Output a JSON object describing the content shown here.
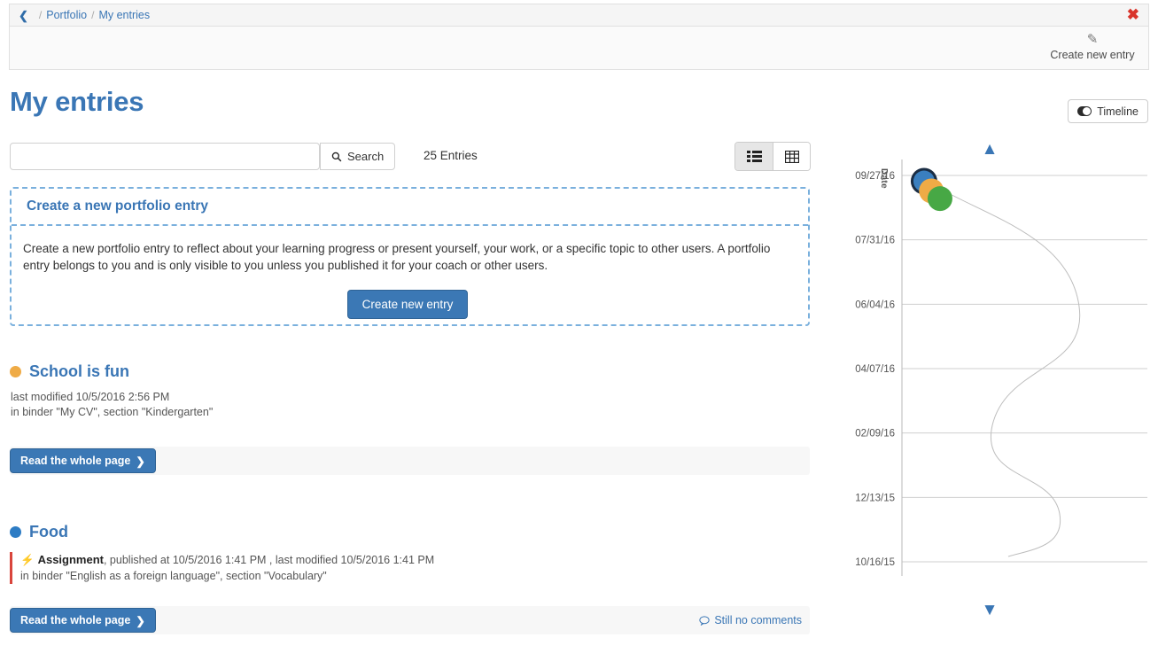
{
  "breadcrumb": {
    "back_icon": "chevron-left-icon",
    "items": [
      "Portfolio",
      "My entries"
    ],
    "separator": "/",
    "close_icon": "close-icon"
  },
  "action_bar": {
    "create_entry": {
      "icon": "pencil-icon",
      "label": "Create new entry"
    }
  },
  "header": {
    "title": "My entries",
    "timeline_toggle": {
      "label": "Timeline",
      "icon": "toggle-switch-icon",
      "state": "on"
    }
  },
  "search": {
    "value": "",
    "placeholder": "",
    "button_label": "Search",
    "button_icon": "search-icon",
    "entries_count": "25 Entries"
  },
  "view_switch": {
    "list": {
      "icon": "list-view-icon",
      "active": true
    },
    "grid": {
      "icon": "grid-view-icon",
      "active": false
    }
  },
  "create_box": {
    "heading": "Create a new portfolio entry",
    "description": "Create a new portfolio entry to reflect about your learning progress or present yourself, your work, or a specific topic to other users. A portfolio entry belongs to you and is only visible to you unless you published it for your coach or other users.",
    "button_label": "Create new entry"
  },
  "entries": [
    {
      "bullet_color": "#efab46",
      "title": "School is fun",
      "meta_lines": [
        "last modified 10/5/2016 2:56 PM",
        "in binder \"My CV\", section \"Kindergarten\""
      ],
      "assignment": null,
      "read_label": "Read the whole page",
      "read_icon": "chevron-right-icon",
      "comments": null
    },
    {
      "bullet_color": "#2d7cc4",
      "title": "Food",
      "meta_lines": [],
      "assignment": {
        "icon": "bolt-icon",
        "name": "Assignment",
        "detail": ", published at 10/5/2016 1:41 PM , last modified 10/5/2016 1:41 PM",
        "location": "in binder \"English as a foreign language\", section \"Vocabulary\""
      },
      "read_label": "Read the whole page",
      "read_icon": "chevron-right-icon",
      "comments": {
        "icon": "comment-icon",
        "label": "Still no comments"
      }
    }
  ],
  "chart_data": {
    "type": "scatter",
    "title": "",
    "xlabel": "",
    "ylabel": "Date",
    "grid": true,
    "legend": "none",
    "scroll_up_icon": "chevron-up-icon",
    "scroll_down_icon": "chevron-down-icon",
    "y_ticks": [
      "09/27/16",
      "07/31/16",
      "06/04/16",
      "04/07/16",
      "02/09/16",
      "12/13/15",
      "10/16/15"
    ],
    "ylim": [
      "10/16/15",
      "09/27/16"
    ],
    "points": [
      {
        "label": "entry-1",
        "color": "#3a7fbf",
        "outline": "#1a2d44",
        "date": "09/27/16",
        "x": 0.09,
        "y": 0.985,
        "r": 12
      },
      {
        "label": "entry-2",
        "color": "#efab46",
        "outline": "none",
        "date": "09/27/16",
        "x": 0.12,
        "y": 0.96,
        "r": 14
      },
      {
        "label": "entry-3",
        "color": "#47a845",
        "outline": "none",
        "date": "09/27/16",
        "x": 0.155,
        "y": 0.94,
        "r": 14
      }
    ],
    "curve_note": "s-shaped connector line through entry positions"
  }
}
